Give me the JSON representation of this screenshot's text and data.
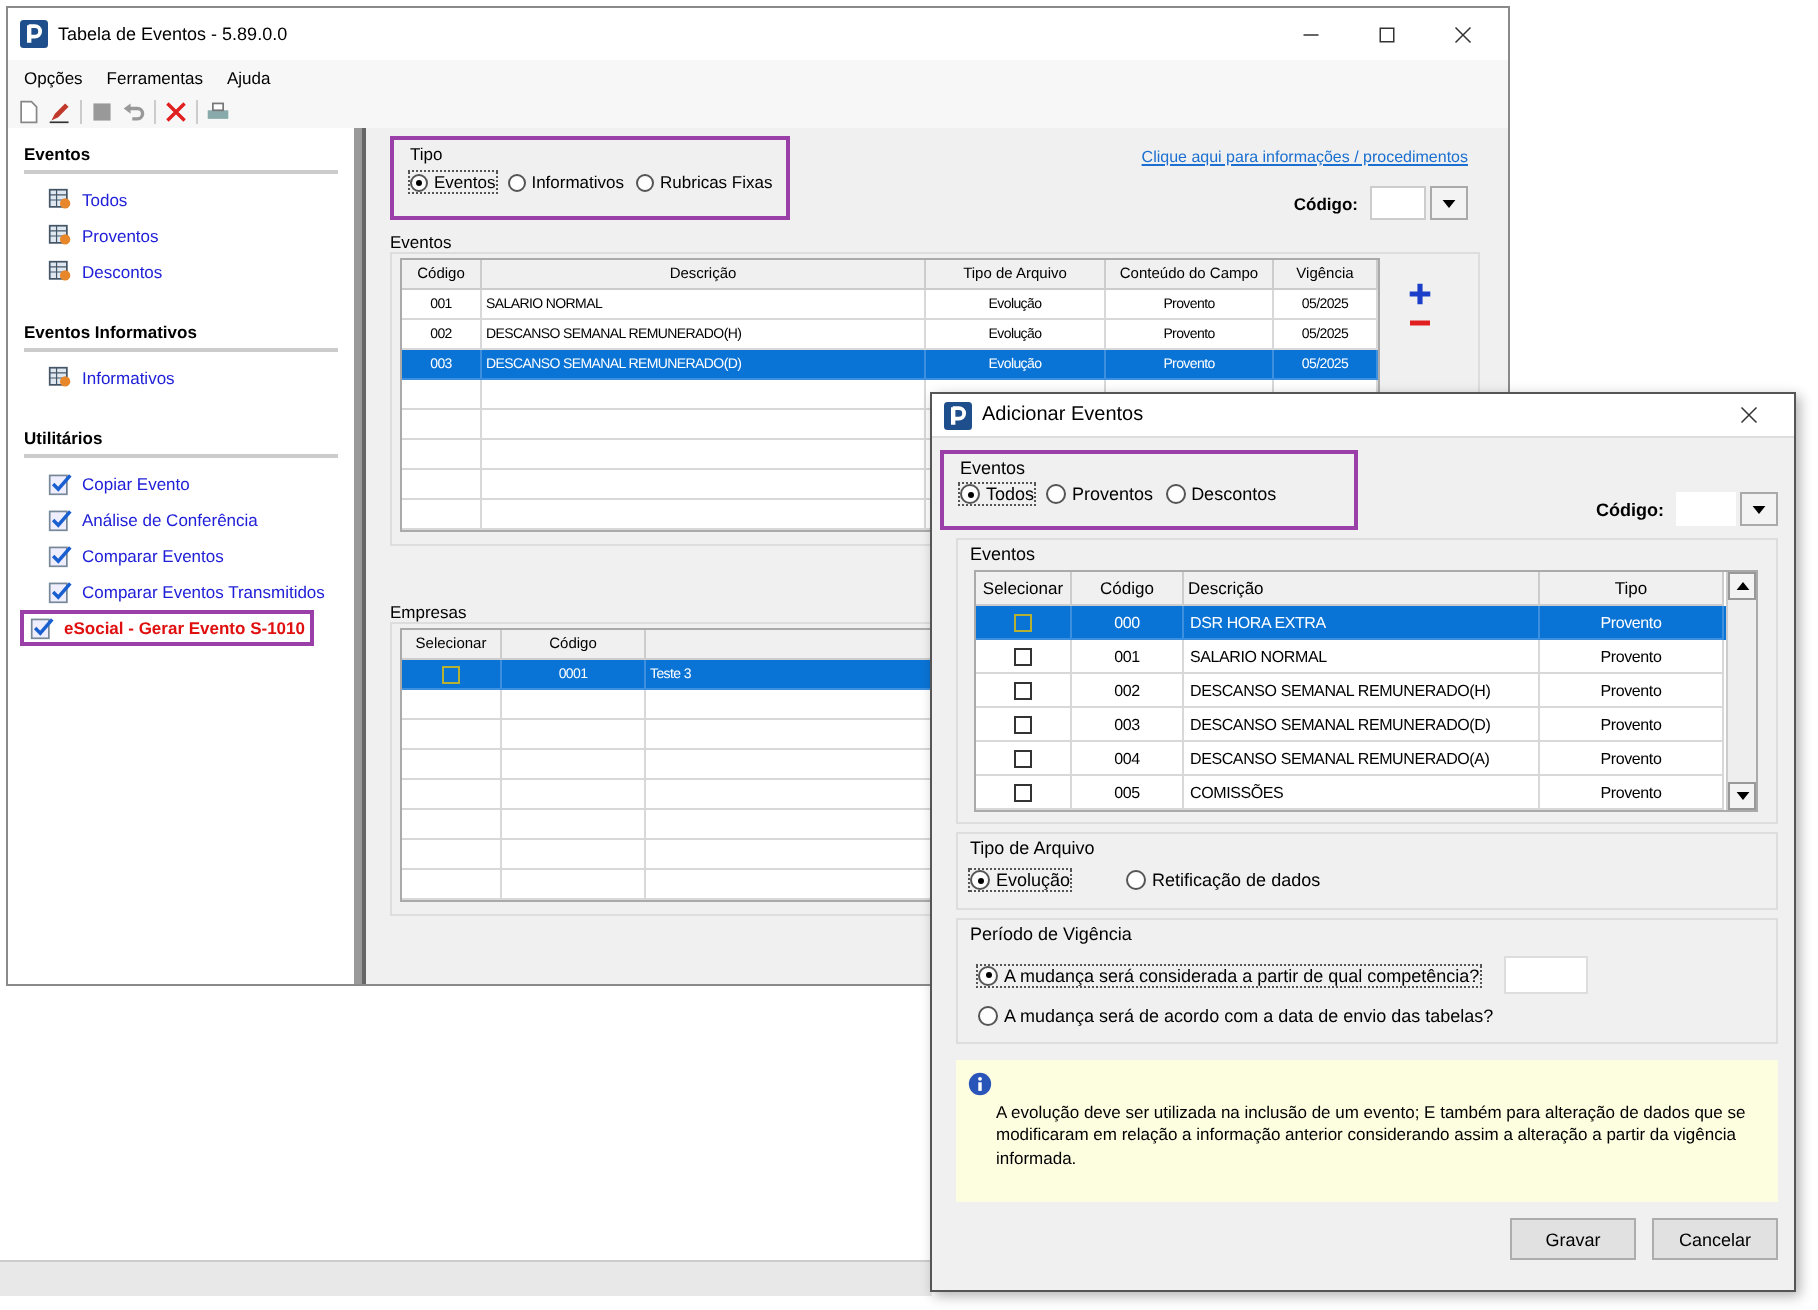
{
  "main_window": {
    "title": "Tabela de Eventos - 5.89.0.0",
    "menu": [
      "Opções",
      "Ferramentas",
      "Ajuda"
    ],
    "sidebar": [
      {
        "title": "Eventos",
        "items": [
          {
            "label": "Todos",
            "kind": "table",
            "highlighted": false
          },
          {
            "label": "Proventos",
            "kind": "table",
            "highlighted": false
          },
          {
            "label": "Descontos",
            "kind": "table",
            "highlighted": false
          }
        ]
      },
      {
        "title": "Eventos Informativos",
        "items": [
          {
            "label": "Informativos",
            "kind": "table",
            "highlighted": false
          }
        ]
      },
      {
        "title": "Utilitários",
        "items": [
          {
            "label": "Copiar Evento",
            "kind": "check",
            "highlighted": false
          },
          {
            "label": "Análise de Conferência",
            "kind": "check",
            "highlighted": false
          },
          {
            "label": "Comparar Eventos",
            "kind": "check",
            "highlighted": false
          },
          {
            "label": "Comparar Eventos Transmitidos",
            "kind": "check",
            "highlighted": false
          },
          {
            "label": "eSocial - Gerar Evento S-1010",
            "kind": "check",
            "highlighted": true
          }
        ]
      }
    ],
    "tipo": {
      "label": "Tipo",
      "highlighted": true,
      "options": [
        {
          "label": "Eventos",
          "selected": true
        },
        {
          "label": "Informativos",
          "selected": false
        },
        {
          "label": "Rubricas Fixas",
          "selected": false
        }
      ]
    },
    "info_link": "Clique aqui para informações / procedimentos",
    "codigo_label": "Código:",
    "events": {
      "title": "Eventos",
      "columns": [
        "Código",
        "Descrição",
        "Tipo de Arquivo",
        "Conteúdo do Campo",
        "Vigência"
      ],
      "rows": [
        {
          "cells": [
            "001",
            "SALARIO NORMAL",
            "Evolução",
            "Provento",
            "05/2025"
          ],
          "selected": false
        },
        {
          "cells": [
            "002",
            "DESCANSO SEMANAL REMUNERADO(H)",
            "Evolução",
            "Provento",
            "05/2025"
          ],
          "selected": false
        },
        {
          "cells": [
            "003",
            "DESCANSO SEMANAL REMUNERADO(D)",
            "Evolução",
            "Provento",
            "05/2025"
          ],
          "selected": true
        }
      ]
    },
    "empresas": {
      "title": "Empresas",
      "columns": [
        "Selecionar",
        "Código"
      ],
      "rows": [
        {
          "checked": false,
          "cells": [
            "",
            "0001",
            "Teste 3"
          ],
          "selected": true
        }
      ]
    }
  },
  "dialog": {
    "title": "Adicionar Eventos",
    "filter": {
      "label": "Eventos",
      "highlighted": true,
      "options": [
        {
          "label": "Todos",
          "selected": true
        },
        {
          "label": "Proventos",
          "selected": false
        },
        {
          "label": "Descontos",
          "selected": false
        }
      ]
    },
    "codigo_label": "Código:",
    "events": {
      "title": "Eventos",
      "columns": [
        "Selecionar",
        "Código",
        "Descrição",
        "Tipo"
      ],
      "rows": [
        {
          "checked": false,
          "cells": [
            "",
            "000",
            "DSR HORA EXTRA",
            "Provento"
          ],
          "selected": true
        },
        {
          "checked": false,
          "cells": [
            "",
            "001",
            "SALARIO NORMAL",
            "Provento"
          ],
          "selected": false
        },
        {
          "checked": false,
          "cells": [
            "",
            "002",
            "DESCANSO SEMANAL REMUNERADO(H)",
            "Provento"
          ],
          "selected": false
        },
        {
          "checked": false,
          "cells": [
            "",
            "003",
            "DESCANSO SEMANAL REMUNERADO(D)",
            "Provento"
          ],
          "selected": false
        },
        {
          "checked": false,
          "cells": [
            "",
            "004",
            "DESCANSO SEMANAL REMUNERADO(A)",
            "Provento"
          ],
          "selected": false
        },
        {
          "checked": false,
          "cells": [
            "",
            "005",
            "COMISSÕES",
            "Provento"
          ],
          "selected": false
        }
      ]
    },
    "tipo_arquivo": {
      "label": "Tipo de Arquivo",
      "options": [
        {
          "label": "Evolução",
          "selected": true
        },
        {
          "label": "Retificação de dados",
          "selected": false
        }
      ]
    },
    "periodo": {
      "label": "Período de Vigência",
      "options": [
        {
          "label": "A mudança será considerada a partir de qual competência?",
          "selected": true,
          "has_field": true
        },
        {
          "label": "A mudança será de acordo com a data de envio das tabelas?",
          "selected": false,
          "has_field": false
        }
      ]
    },
    "info_text": "A evolução deve ser utilizada na inclusão de um evento; E também para alteração de dados que se modificaram em relação a informação anterior considerando assim a alteração a partir da vigência informada.",
    "buttons": [
      "Gravar",
      "Cancelar"
    ]
  }
}
